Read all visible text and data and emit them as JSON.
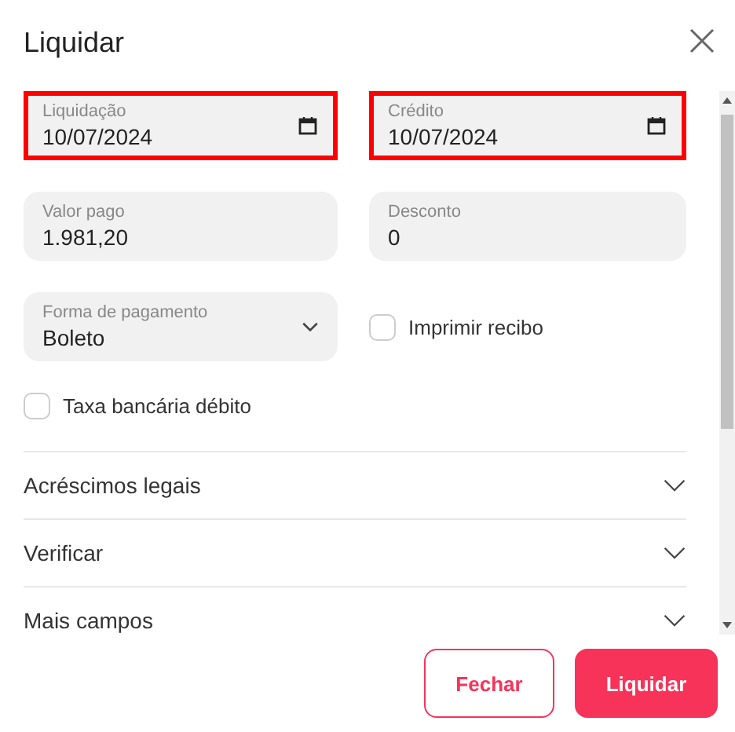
{
  "dialog": {
    "title": "Liquidar"
  },
  "fields": [
    {
      "kind": "date",
      "label": "Liquidação",
      "value": "10/07/2024",
      "invalid": true
    },
    {
      "kind": "date",
      "label": "Crédito",
      "value": "10/07/2024",
      "invalid": true
    },
    {
      "kind": "text",
      "label": "Valor pago",
      "value": "1.981,20",
      "invalid": false
    },
    {
      "kind": "text",
      "label": "Desconto",
      "value": "0",
      "invalid": false
    },
    {
      "kind": "select",
      "label": "Forma de pagamento",
      "value": "Boleto",
      "invalid": false
    },
    {
      "kind": "checkbox",
      "label": "Imprimir recibo",
      "checked": false
    }
  ],
  "extra_checkbox": {
    "label": "Taxa bancária débito",
    "checked": false
  },
  "sections": [
    {
      "label": "Acréscimos legais",
      "expanded": false
    },
    {
      "label": "Verificar",
      "expanded": false
    },
    {
      "label": "Mais campos",
      "expanded": false
    }
  ],
  "buttons": [
    {
      "label": "Fechar",
      "kind": "secondary"
    },
    {
      "label": "Liquidar",
      "kind": "primary"
    }
  ]
}
